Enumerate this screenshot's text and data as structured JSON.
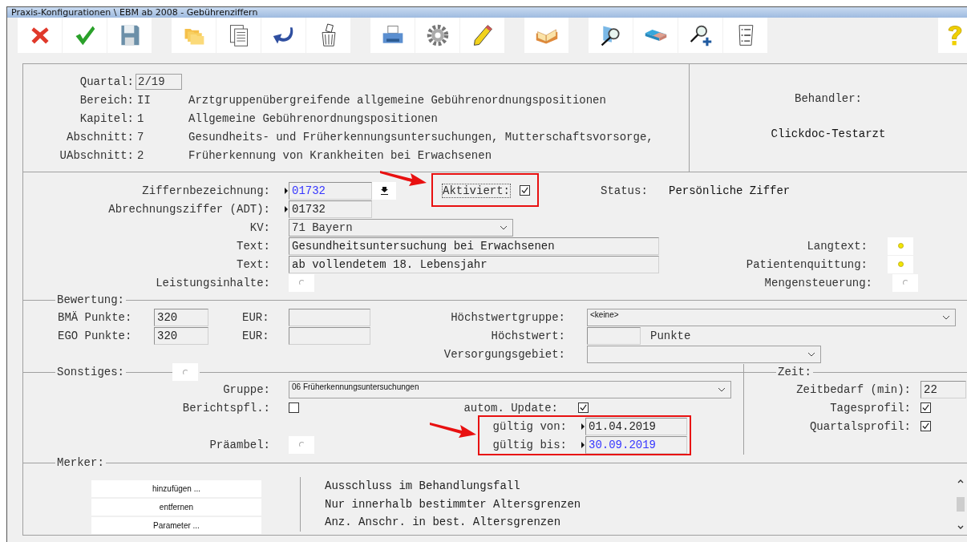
{
  "window": {
    "title": "Praxis-Konfigurationen \\ EBM ab 2008 - Gebührenziffern"
  },
  "header": {
    "quartal": {
      "label": "Quartal:",
      "value": "2/19"
    },
    "rows": [
      {
        "label": "Bereich:",
        "code": "II",
        "text": "Arztgruppenübergreifende allgemeine Gebührenordnungspositionen"
      },
      {
        "label": "Kapitel:",
        "code": "1",
        "text": "Allgemeine Gebührenordnungspositionen"
      },
      {
        "label": "Abschnitt:",
        "code": "7",
        "text": "Gesundheits- und Früherkennungsuntersuchungen, Mutterschaftsvorsorge,"
      },
      {
        "label": "UAbschnitt:",
        "code": "2",
        "text": "Früherkennung von Krankheiten bei Erwachsenen"
      }
    ],
    "behandler": {
      "label": "Behandler:",
      "value": "Clickdoc-Testarzt"
    }
  },
  "ziffer": {
    "ziffernbezeichnung": {
      "label": "Ziffernbezeichnung:",
      "value": "01732",
      "highlighted": true
    },
    "abrechnungsziffer": {
      "label": "Abrechnungsziffer (ADT):",
      "value": "01732",
      "highlighted": false
    },
    "aktiviert": {
      "label": "Aktiviert:",
      "checked": true
    },
    "status": {
      "label": "Status:",
      "value": "Persönliche Ziffer"
    },
    "kv": {
      "label": "KV:",
      "value": "71 Bayern"
    },
    "texts": [
      {
        "label": "Text:",
        "value": "Gesundheitsuntersuchung bei Erwachsenen"
      },
      {
        "label": "Text:",
        "value": "ab vollendetem 18. Lebensjahr"
      }
    ],
    "leistungsinhalte": {
      "label": "Leistungsinhalte:",
      "set": false
    },
    "options": [
      {
        "label": "Langtext:",
        "set": true
      },
      {
        "label": "Patientenquittung:",
        "set": true
      },
      {
        "label": "Mengensteuerung:",
        "set": false
      }
    ]
  },
  "bewertung": {
    "title": "Bewertung:",
    "rows": [
      {
        "label": "BMÄ Punkte:",
        "punkte": "320",
        "eur_label": "EUR:"
      },
      {
        "label": "EGO Punkte:",
        "punkte": "320",
        "eur_label": "EUR:"
      }
    ],
    "hoechstwertgruppe": {
      "label": "Höchstwertgruppe:",
      "value": "<keine>"
    },
    "hoechstwert": {
      "label": "Höchstwert:",
      "unit": "Punkte"
    },
    "versorgungsgebiet": {
      "label": "Versorgungsgebiet:"
    }
  },
  "sonstiges": {
    "title": "Sonstiges:",
    "set": false,
    "gruppe": {
      "label": "Gruppe:",
      "value": "06 Früherkennungsuntersuchungen"
    },
    "berichtspflicht": {
      "label": "Berichtspfl.:",
      "checked": false
    },
    "autom_update": {
      "label": "autom. Update:",
      "checked": true
    },
    "gueltig": [
      {
        "label": "gültig von:",
        "value": "01.04.2019",
        "highlighted": false
      },
      {
        "label": "gültig bis:",
        "value": "30.09.2019",
        "highlighted": true
      }
    ],
    "praeambel": {
      "label": "Präambel:",
      "set": false
    }
  },
  "zeit": {
    "title": "Zeit:",
    "zeitbedarf": {
      "label": "Zeitbedarf (min):",
      "value": "22"
    },
    "profile": [
      {
        "label": "Tagesprofil:",
        "checked": true
      },
      {
        "label": "Quartalsprofil:",
        "checked": true
      }
    ]
  },
  "merker": {
    "title": "Merker:",
    "buttons": [
      "hinzufügen ...",
      "entfernen",
      "Parameter ..."
    ],
    "items": [
      "Ausschluss im Behandlungsfall",
      "Nur innerhalb bestimmter Altersgrenzen",
      "Anz. Anschr. in best. Altersgrenzen"
    ]
  }
}
